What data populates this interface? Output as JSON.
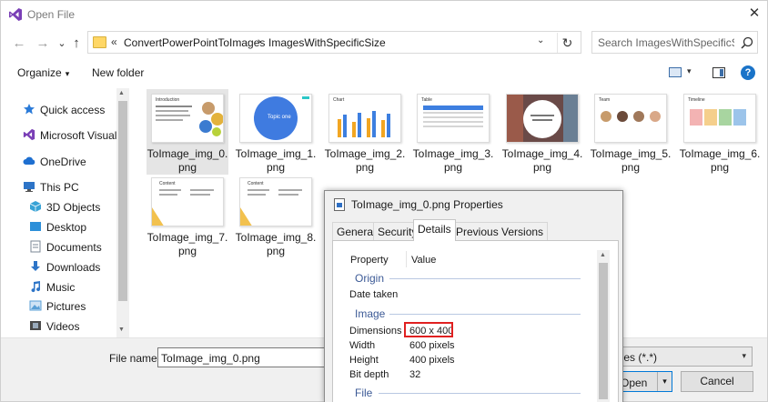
{
  "window": {
    "title": "Open File",
    "close_glyph": "✕"
  },
  "address": {
    "overflow": "«",
    "crumbs": [
      "ConvertPowerPointToImages",
      "ImagesWithSpecificSize"
    ],
    "separator": "›",
    "dropdown": "⌄",
    "refresh": "↻"
  },
  "search": {
    "placeholder": "Search ImagesWithSpecificSize"
  },
  "toolbar": {
    "organize": "Organize",
    "organize_caret": "▾",
    "new_folder": "New folder",
    "view_caret": "▾",
    "help": "?"
  },
  "nav_buttons": {
    "back": "←",
    "forward": "→",
    "recent": "⌄",
    "up": "↑"
  },
  "nav": {
    "items": [
      {
        "label": "Quick access",
        "icon": "star-icon",
        "color": "#2a7ad8"
      },
      {
        "label": "Microsoft Visual S",
        "icon": "visual-studio-icon",
        "color": "#7a3fb6"
      },
      {
        "label": "OneDrive",
        "icon": "cloud-icon",
        "color": "#1e6fd0"
      },
      {
        "label": "This PC",
        "icon": "computer-icon",
        "color": "#2d74c7"
      },
      {
        "label": "3D Objects",
        "icon": "cube-icon",
        "color": "#38a3d6"
      },
      {
        "label": "Desktop",
        "icon": "desktop-icon",
        "color": "#2c8fd9"
      },
      {
        "label": "Documents",
        "icon": "documents-icon",
        "color": "#7b8794"
      },
      {
        "label": "Downloads",
        "icon": "download-icon",
        "color": "#2d74c7"
      },
      {
        "label": "Music",
        "icon": "music-icon",
        "color": "#2d74c7"
      },
      {
        "label": "Pictures",
        "icon": "pictures-icon",
        "color": "#5a9fd6"
      },
      {
        "label": "Videos",
        "icon": "video-icon",
        "color": "#4a4a4a"
      }
    ]
  },
  "files": [
    {
      "name": "ToImage_img_0.png",
      "slide_title": "Introduction",
      "selected": true
    },
    {
      "name": "ToImage_img_1.png",
      "slide_title": "Topic one",
      "selected": false
    },
    {
      "name": "ToImage_img_2.png",
      "slide_title": "Chart",
      "selected": false
    },
    {
      "name": "ToImage_img_3.png",
      "slide_title": "Table",
      "selected": false
    },
    {
      "name": "ToImage_img_4.png",
      "slide_title": "",
      "selected": false
    },
    {
      "name": "ToImage_img_5.png",
      "slide_title": "Team",
      "selected": false
    },
    {
      "name": "ToImage_img_6.png",
      "slide_title": "Timeline",
      "selected": false
    },
    {
      "name": "ToImage_img_7.png",
      "slide_title": "Content",
      "selected": false
    },
    {
      "name": "ToImage_img_8.png",
      "slide_title": "Content",
      "selected": false
    }
  ],
  "bottom": {
    "file_name_label": "File name:",
    "file_name_value": "ToImage_img_0.png",
    "filter": "iles (*.*)",
    "open": "Open",
    "open_caret": "▾",
    "cancel": "Cancel"
  },
  "properties": {
    "title": "ToImage_img_0.png Properties",
    "tabs": [
      {
        "label": "General",
        "active": false
      },
      {
        "label": "Security",
        "active": false
      },
      {
        "label": "Details",
        "active": true
      },
      {
        "label": "Previous Versions",
        "active": false
      }
    ],
    "headers": {
      "property": "Property",
      "value": "Value"
    },
    "groups": {
      "origin": "Origin",
      "image": "Image",
      "file": "File"
    },
    "rows": {
      "date_taken": {
        "key": "Date taken",
        "value": ""
      },
      "dimensions": {
        "key": "Dimensions",
        "value": "600 x 400"
      },
      "width": {
        "key": "Width",
        "value": "600 pixels"
      },
      "height": {
        "key": "Height",
        "value": "400 pixels"
      },
      "bit_depth": {
        "key": "Bit depth",
        "value": "32"
      }
    },
    "highlight_color": "#e02020"
  },
  "colors": {
    "accent": "#0078d7",
    "selected_tile": "#e5e5e5",
    "group_header": "#3c5a96"
  }
}
